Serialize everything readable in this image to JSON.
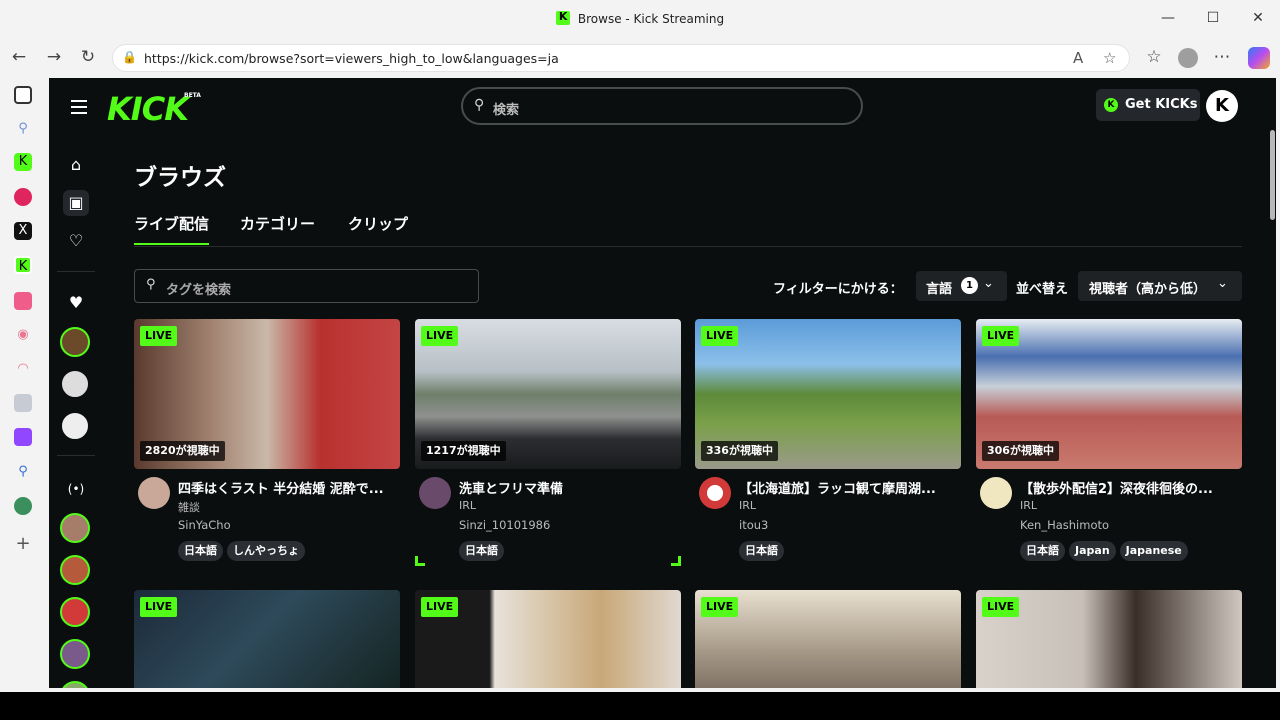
{
  "window": {
    "title": "Browse - Kick Streaming",
    "url": "https://kick.com/browse?sort=viewers_high_to_low&languages=ja"
  },
  "header": {
    "logo": "KICK",
    "beta": "BETA",
    "search_placeholder": "検索",
    "get_kicks": "Get KICKs",
    "user_initial": "K"
  },
  "page": {
    "title": "ブラウズ",
    "tabs": [
      {
        "label": "ライブ配信"
      },
      {
        "label": "カテゴリー"
      },
      {
        "label": "クリップ"
      }
    ],
    "tag_search_placeholder": "タグを検索",
    "filter_label": "フィルターにかける：",
    "language_label": "言語",
    "language_count": "1",
    "sort_label": "並べ替え",
    "sort_value": "視聴者（高から低）"
  },
  "streams": [
    {
      "live": "LIVE",
      "viewers": "2820が視聴中",
      "title": "四季はくラスト 半分結婚 泥酔で...",
      "category": "雑談",
      "name": "SinYaCho",
      "tags": [
        "日本語",
        "しんやっちょ"
      ]
    },
    {
      "live": "LIVE",
      "viewers": "1217が視聴中",
      "title": "洗車とフリマ準備",
      "category": "IRL",
      "name": "Sinzi_10101986",
      "tags": [
        "日本語"
      ]
    },
    {
      "live": "LIVE",
      "viewers": "336が視聴中",
      "title": "【北海道旅】ラッコ観て摩周湖...",
      "category": "IRL",
      "name": "itou3",
      "tags": [
        "日本語"
      ]
    },
    {
      "live": "LIVE",
      "viewers": "306が視聴中",
      "title": "【散歩外配信2】深夜徘徊後の...",
      "category": "IRL",
      "name": "Ken_Hashimoto",
      "tags": [
        "日本語",
        "Japan",
        "Japanese"
      ]
    }
  ],
  "row2": [
    {
      "live": "LIVE"
    },
    {
      "live": "LIVE"
    },
    {
      "live": "LIVE"
    },
    {
      "live": "LIVE"
    }
  ],
  "colors": {
    "accent": "#53fc18",
    "background": "#0b0e0f"
  }
}
